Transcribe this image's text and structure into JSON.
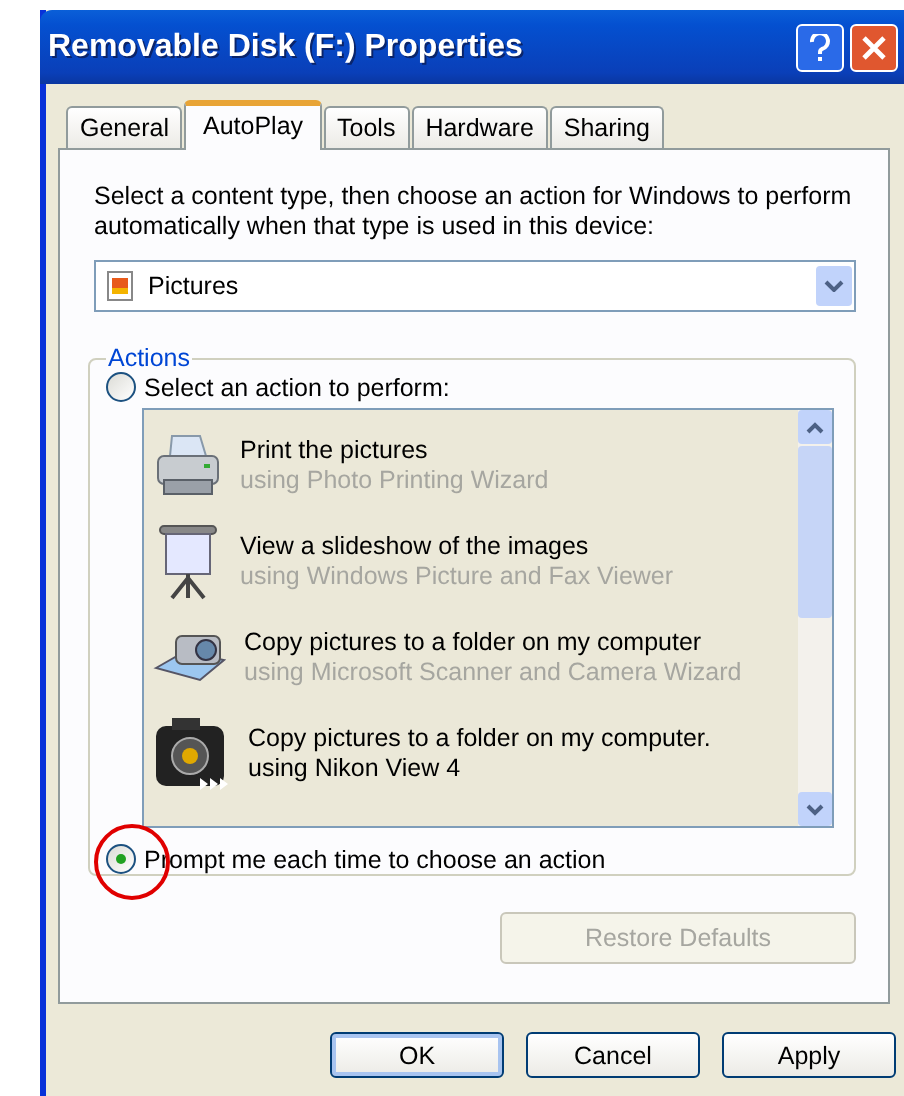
{
  "window": {
    "title": "Removable Disk (F:) Properties"
  },
  "tabs": [
    {
      "label": "General",
      "selected": false
    },
    {
      "label": "AutoPlay",
      "selected": true
    },
    {
      "label": "Tools",
      "selected": false
    },
    {
      "label": "Hardware",
      "selected": false
    },
    {
      "label": "Sharing",
      "selected": false
    }
  ],
  "description": "Select a content type, then choose an action for Windows to perform automatically when that type is used in this device:",
  "content_type": {
    "value": "Pictures"
  },
  "actions": {
    "title": "Actions",
    "options": [
      {
        "label": "Select an action to perform:",
        "selected": false
      },
      {
        "label": "Prompt me each time to choose an action",
        "selected": true
      }
    ],
    "list_disabled": true,
    "items": [
      {
        "kind": "printer",
        "title": "Print the pictures",
        "subtitle": "using Photo Printing Wizard",
        "dim": true
      },
      {
        "kind": "slideshow",
        "title": "View a slideshow of the images",
        "subtitle": "using Windows Picture and Fax Viewer",
        "dim": true
      },
      {
        "kind": "scanner",
        "title": "Copy pictures to a folder on my computer",
        "subtitle": "using Microsoft Scanner and Camera Wizard",
        "dim": true
      },
      {
        "kind": "camera",
        "title": "Copy pictures to a folder on my computer.",
        "subtitle": "using Nikon View 4",
        "dim": false
      }
    ]
  },
  "restore_button": {
    "label": "Restore Defaults",
    "disabled": true
  },
  "buttons": [
    {
      "label": "OK",
      "default": true
    },
    {
      "label": "Cancel",
      "default": false
    },
    {
      "label": "Apply",
      "default": false
    }
  ]
}
